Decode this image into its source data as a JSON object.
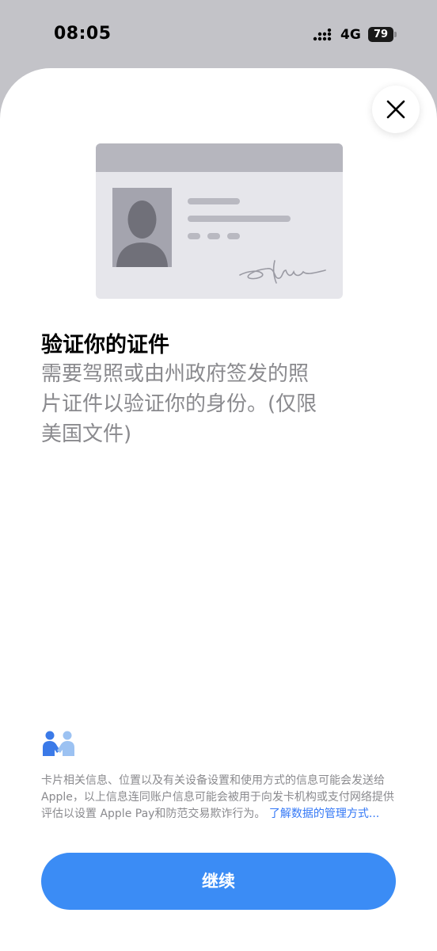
{
  "status_bar": {
    "time": "08:05",
    "network": "4G",
    "battery": "79"
  },
  "content": {
    "title": "验证你的证件",
    "description": "需要驾照或由州政府签发的照片证件以验证你的身份。(仅限美国文件)"
  },
  "privacy": {
    "text": "卡片相关信息、位置以及有关设备设置和使用方式的信息可能会发送给Apple，以上信息连同账户信息可能会被用于向发卡机构或支付网络提供评估以设置 Apple Pay和防范交易欺诈行为。",
    "link": "了解数据的管理方式..."
  },
  "actions": {
    "continue_label": "继续"
  },
  "icons": {
    "close": "close-icon",
    "signal": "cellular-signal-icon",
    "privacy": "handshake-privacy-icon",
    "card": "id-card-illustration"
  },
  "colors": {
    "accent": "#3b8cf5",
    "link": "#3478f6",
    "secondary_text": "#8a8a8e",
    "backdrop": "#c3c3c8"
  }
}
